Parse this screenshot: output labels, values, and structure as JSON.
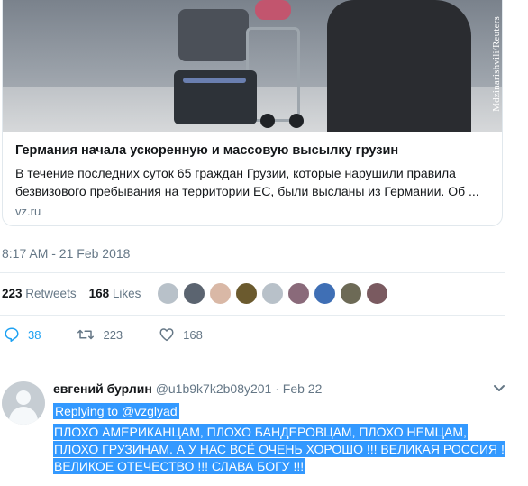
{
  "card": {
    "photo_credit": "Mdzinarishvili/Reuters",
    "title": "Германия начала ускоренную и массовую высылку грузин",
    "description": "В течение последних суток 65 граждан Грузии, которые нарушили правила безвизового пребывания на территории ЕС, были высланы из Германии. Об ...",
    "domain": "vz.ru"
  },
  "tweet": {
    "timestamp": "8:17 AM - 21 Feb 2018",
    "retweets_count": "223",
    "retweets_label": "Retweets",
    "likes_count": "168",
    "likes_label": "Likes"
  },
  "likers": [
    {
      "icon": "avatar-default",
      "color": "#b8c1c9"
    },
    {
      "icon": "avatar-photo",
      "color": "#5b6470"
    },
    {
      "icon": "avatar-photo",
      "color": "#d9b8a6"
    },
    {
      "icon": "avatar-photo",
      "color": "#6b5a2e"
    },
    {
      "icon": "avatar-default",
      "color": "#b8c1c9"
    },
    {
      "icon": "avatar-photo",
      "color": "#8a6a7a"
    },
    {
      "icon": "avatar-photo",
      "color": "#3f6fb5"
    },
    {
      "icon": "avatar-photo",
      "color": "#6d6a56"
    },
    {
      "icon": "avatar-photo",
      "color": "#7a5a60"
    }
  ],
  "actions": {
    "reply_count": "38",
    "retweet_count": "223",
    "like_count": "168"
  },
  "reply": {
    "name": "евгений бурлин",
    "handle": "@u1b9k7k2b08y201",
    "separator": "·",
    "date": "Feb 22",
    "replying_to": "Replying to @vzglyad",
    "text": "ПЛОХО АМЕРИКАНЦАМ, ПЛОХО БАНДЕРОВЦАМ, ПЛОХО НЕМЦАМ, ПЛОХО ГРУЗИНАМ.  А У НАС ВСЁ ОЧЕНЬ ХОРОШО !!! ВЕЛИКАЯ РОССИЯ ! ВЕЛИКОЕ ОТЕЧЕСТВО !!! СЛАВА БОГУ !!!"
  },
  "colors": {
    "accent": "#1da1f2",
    "muted": "#657786",
    "selection": "#3399ff"
  }
}
